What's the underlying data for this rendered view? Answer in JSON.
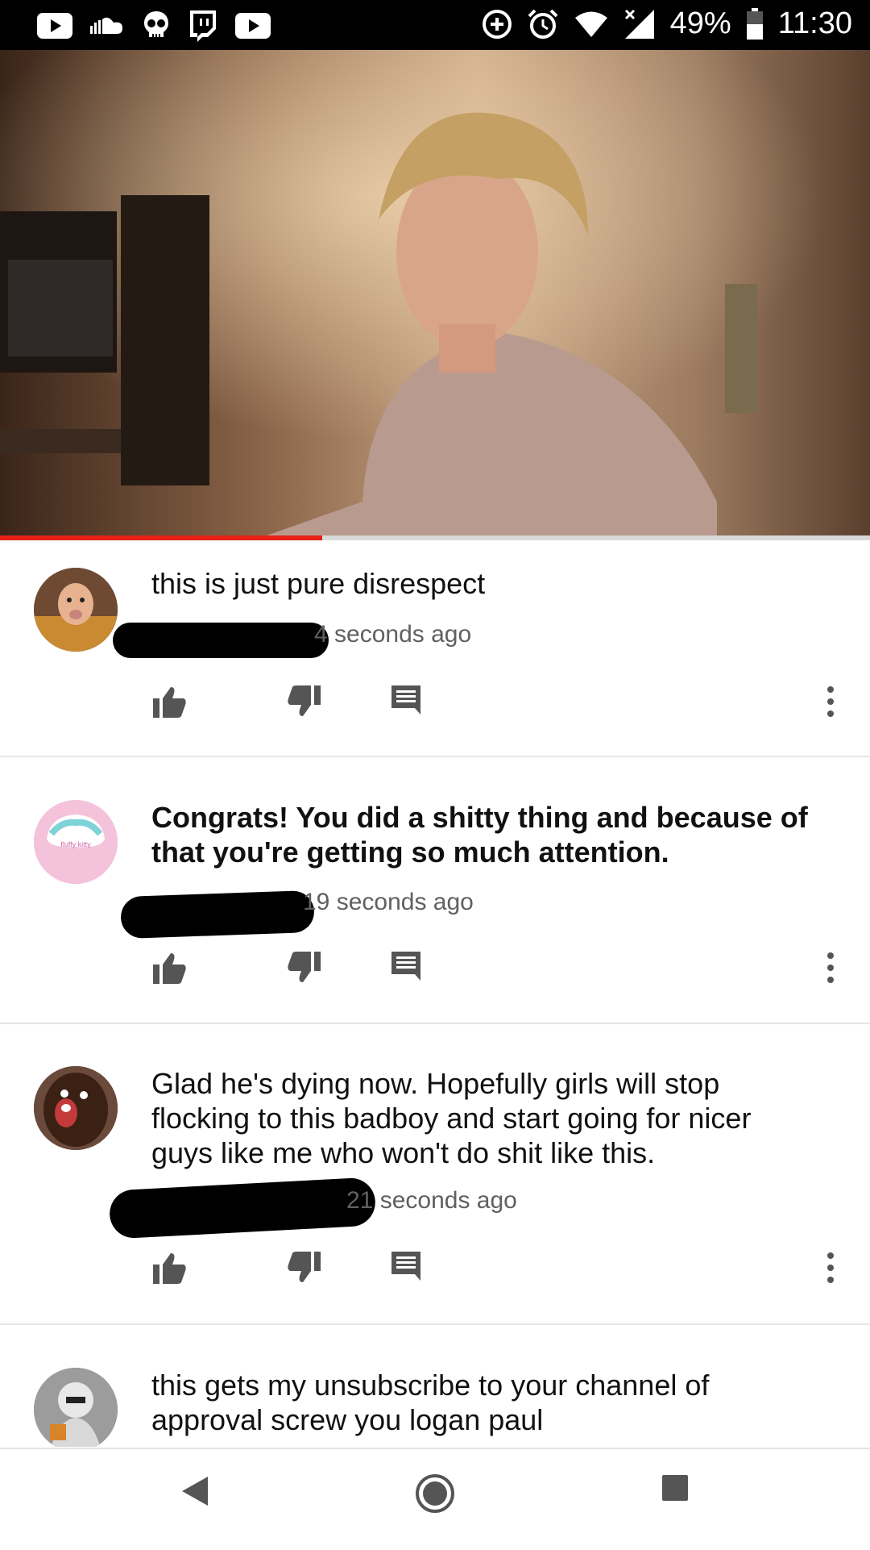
{
  "status_bar": {
    "battery": "49%",
    "time": "11:30",
    "left_icons": [
      "youtube-icon",
      "soundcloud-icon",
      "skull-icon",
      "twitch-icon",
      "youtube-icon"
    ],
    "right_icons": [
      "data-saver-icon",
      "alarm-icon",
      "wifi-icon",
      "signal-icon",
      "battery-icon"
    ]
  },
  "video": {
    "progress_fraction": 0.37,
    "accent": "#e62117"
  },
  "comments": [
    {
      "text": "this is just pure disrespect",
      "time": "4 seconds ago",
      "bold": false
    },
    {
      "text": "Congrats! You did a shitty thing and because of that you're getting so much attention.",
      "time": "19 seconds ago",
      "bold": true,
      "avatar_caption": "fluffy kitty"
    },
    {
      "text": "Glad he's dying now. Hopefully girls will stop flocking to this badboy and start going for nicer guys like me who won't do shit like this.",
      "time": "21 seconds ago",
      "bold": false
    },
    {
      "text": "this gets my unsubscribe to your channel of approval screw you logan paul",
      "time": "",
      "bold": false
    }
  ],
  "nav": {
    "icons": [
      "back-icon",
      "home-icon",
      "recents-icon"
    ]
  }
}
